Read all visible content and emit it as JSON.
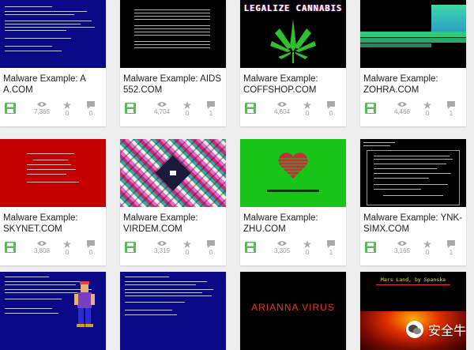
{
  "cards": [
    {
      "title": "Malware Example: A A.COM",
      "views": "7,365",
      "stars": "0",
      "comments": "0"
    },
    {
      "title": "Malware Example: AIDS 552.COM",
      "views": "4,704",
      "stars": "0",
      "comments": "1"
    },
    {
      "title": "Malware Example: COFFSHOP.COM",
      "views": "4,604",
      "stars": "0",
      "comments": "0"
    },
    {
      "title": "Malware Example: ZOHRA.COM",
      "views": "4,466",
      "stars": "0",
      "comments": "1"
    },
    {
      "title": "Malware Example: SKYNET.COM",
      "views": "3,808",
      "stars": "0",
      "comments": "0"
    },
    {
      "title": "Malware Example: VIRDEM.COM",
      "views": "3,319",
      "stars": "0",
      "comments": "0"
    },
    {
      "title": "Malware Example: ZHU.COM",
      "views": "3,305",
      "stars": "0",
      "comments": "1"
    },
    {
      "title": "Malware Example: YNK-SIMX.COM",
      "views": "3,165",
      "stars": "0",
      "comments": "1"
    }
  ],
  "thumb_text": {
    "coffshop_banner": "LEGALIZE CANNABIS",
    "arianna": "ARIANNA VIRUS",
    "last_card_title": "Mars Land, by Spanska"
  },
  "watermark": "安全牛",
  "colors": {
    "accent_green": "#4caf50",
    "icon_gray": "#aaaaaa"
  }
}
